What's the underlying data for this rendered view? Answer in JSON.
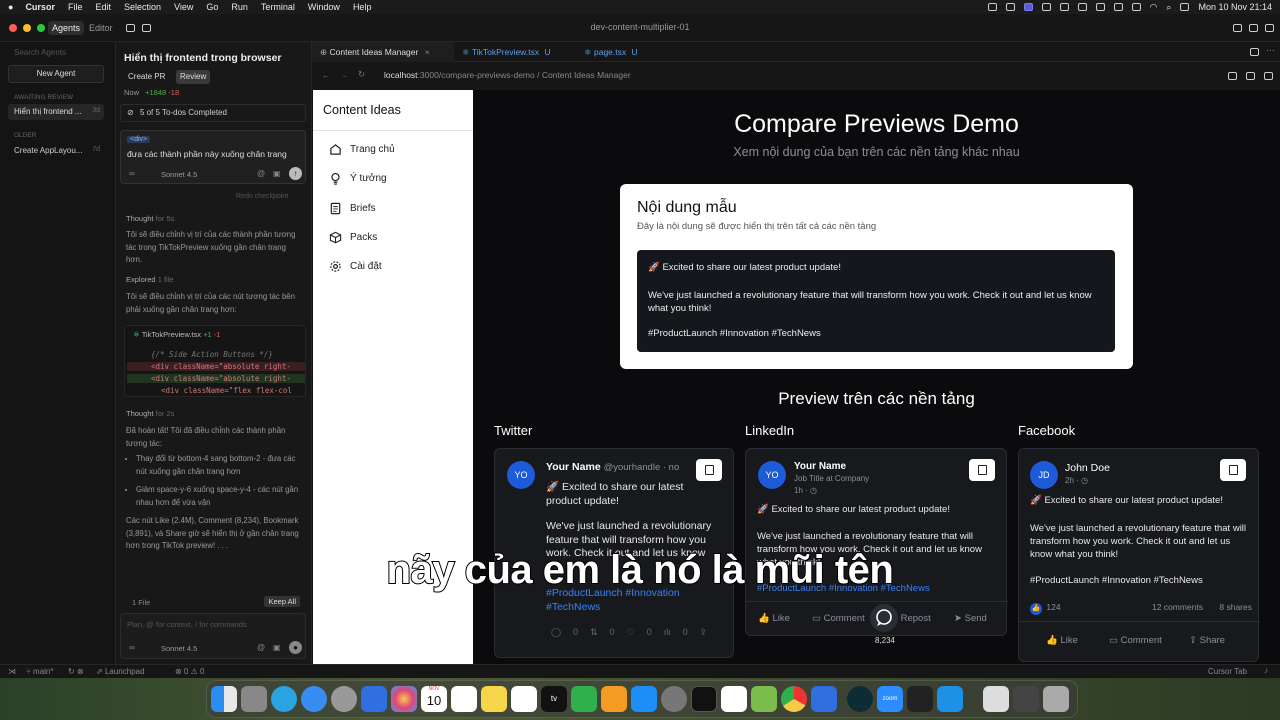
{
  "menubar": {
    "app": "Cursor",
    "items": [
      "File",
      "Edit",
      "Selection",
      "View",
      "Go",
      "Run",
      "Terminal",
      "Window",
      "Help"
    ],
    "clock": "Mon 10 Nov  21:14"
  },
  "window": {
    "title": "dev-content-multiplier-01",
    "mode_agents": "Agents",
    "mode_editor": "Editor"
  },
  "agents_panel": {
    "search_placeholder": "Search Agents",
    "new_agent": "New Agent",
    "awaiting_heading": "AWAITING REVIEW",
    "awaiting_item": "Hiển thị frontend ...",
    "awaiting_age": "3d",
    "older_heading": "OLDER",
    "older_item": "Create AppLayou...",
    "older_age": "7d"
  },
  "chat": {
    "title": "Hiển thị frontend trong browser",
    "create_pr": "Create PR",
    "review": "Review",
    "time": "Now",
    "additions": "+1848",
    "deletions": "-18",
    "todos": "5 of 5 To-dos Completed",
    "context_tag": "<div>",
    "message": "đưa các thành phần này xuống chân trang",
    "model": "Sonnet 4.5",
    "infinity": "∞",
    "redo": "Redo checkpoint",
    "thought1_label": "Thought",
    "thought1_time": "for 5s",
    "para1": "Tôi sẽ điều chỉnh vị trí của các thành phần tương tác trong TikTokPreview xuống gần chân trang hơn.",
    "explored_label": "Explored",
    "explored_count": "1 file",
    "para2": "Tôi sẽ điều chỉnh vị trí của các nút tương tác bên phải xuống gần chân trang hơn:",
    "diff_file": "TikTokPreview.tsx",
    "diff_add": "+1",
    "diff_del": "-1",
    "code_lines": [
      "{/* Side Action Buttons */}",
      "<div className=\"absolute right-",
      "<div className=\"absolute right-",
      "<div className=\"flex flex-col"
    ],
    "thought2_label": "Thought",
    "thought2_time": "for 2s",
    "para3": "Đã hoàn tất! Tôi đã điều chỉnh các thành phần tương tác:",
    "bullet1": "Thay đổi từ bottom-4 sang bottom-2 - đưa các nút xuống gần chân trang hơn",
    "bullet2": "Giảm space-y-6 xuống space-y-4 - các nút gần nhau hơn để vừa vặn",
    "para4": "Các nút Like (2.4M), Comment (8,234), Bookmark (3,891), và Share giờ sẽ hiển thị ở gần chân trang hơn trong TikTok preview! . . .",
    "files_count": "1 File",
    "keep_all": "Keep All",
    "input_placeholder": "Plan, @ for context, / for commands",
    "model2": "Sonnet 4.5"
  },
  "tabs": [
    {
      "label": "Content Ideas Manager",
      "suffix": ""
    },
    {
      "label": "TikTokPreview.tsx",
      "suffix": "U"
    },
    {
      "label": "page.tsx",
      "suffix": "U"
    }
  ],
  "url": {
    "host": "localhost",
    "path": ":3000/compare-previews-demo / Content Ideas Manager"
  },
  "app_sidebar": {
    "brand": "Content Ideas",
    "items": [
      "Trang chủ",
      "Ý tưởng",
      "Briefs",
      "Packs",
      "Cài đặt"
    ]
  },
  "preview": {
    "title": "Compare Previews Demo",
    "subtitle": "Xem nội dung của bạn trên các nền tảng khác nhau",
    "sample_title": "Nội dung mẫu",
    "sample_desc": "Đây là nội dung sẽ được hiển thị trên tất cả các nền tảng",
    "sample_line1": "🚀 Excited to share our latest product update!",
    "sample_line2": "We've just launched a revolutionary feature that will transform how you work. Check it out and let us know what you think!",
    "sample_line3": "#ProductLaunch #Innovation #TechNews",
    "platforms_heading": "Preview trên các nền tảng"
  },
  "twitter": {
    "label": "Twitter",
    "avatar": "YO",
    "name": "Your Name",
    "handle": "@yourhandle · no",
    "line1": "🚀 Excited to share our latest product update!",
    "line2": "We've just launched a revolutionary feature that will transform how you work. Check it out and let us know",
    "tags": "#ProductLaunch #Innovation #TechNews",
    "counts": [
      "0",
      "0",
      "0",
      "0"
    ]
  },
  "linkedin": {
    "label": "LinkedIn",
    "avatar": "YO",
    "name": "Your Name",
    "title": "Job Title at Company",
    "time": "1h · ◷",
    "line1": "🚀 Excited to share our latest product update!",
    "line2": "We've just launched a revolutionary feature that will transform how you work. Check it out and let us know what you think!",
    "tags": "#ProductLaunch #Innovation #TechNews",
    "actions": [
      "Like",
      "Comment",
      "Repost",
      "Send"
    ]
  },
  "facebook": {
    "label": "Facebook",
    "avatar": "JD",
    "name": "John Doe",
    "time": "2h · ◷",
    "line1": "🚀 Excited to share our latest product update!",
    "line2": "We've just launched a revolutionary feature that will transform how you work. Check it out and let us know what you think!",
    "tags": "#ProductLaunch #Innovation #TechNews",
    "likes": "124",
    "comments": "12 comments",
    "shares": "8 shares",
    "actions": [
      "Like",
      "Comment",
      "Share"
    ]
  },
  "floating_count": "8,234",
  "statusbar": {
    "branch": "main*",
    "launchpad": "Launchpad",
    "problems": "⊗ 0 ⚠ 0",
    "cursor_tab": "Cursor Tab"
  },
  "dock_calendar": {
    "month": "NOV",
    "day": "10"
  },
  "subtitle": "nãy của em là nó là mũi tên",
  "colors": {
    "accent": "#1e5bd8",
    "bg": "#0b0b0d",
    "card": "#17191d",
    "link": "#3b82f6"
  }
}
